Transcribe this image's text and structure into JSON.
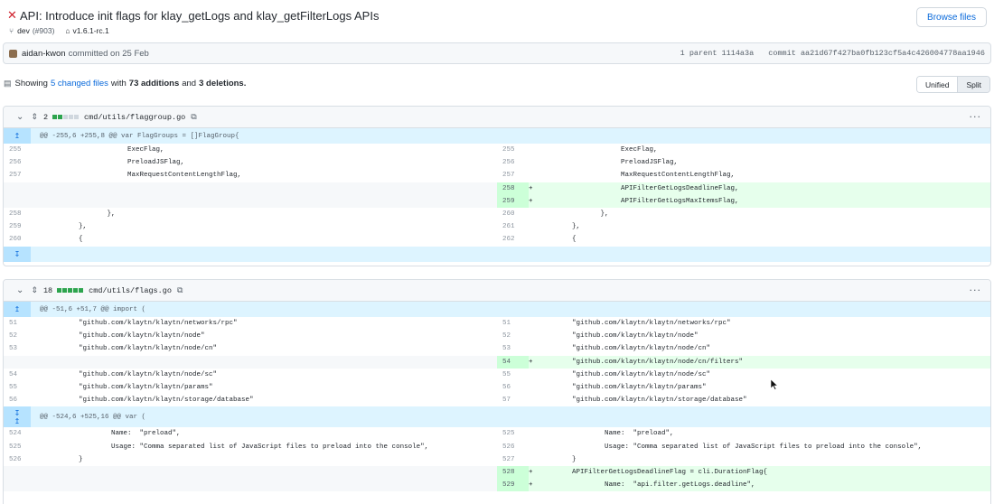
{
  "header": {
    "title": "API: Introduce init flags for klay_getLogs and klay_getFilterLogs APIs",
    "branch": "dev",
    "pr": "(#903)",
    "tag": "v1.6.1-rc.1",
    "browse_files": "Browse files"
  },
  "commit": {
    "author": "aidan-kwon",
    "text": "committed on 25 Feb",
    "parent": "1 parent 1114a3a",
    "hash": "commit aa21d67f427ba0fb123cf5a4c426004778aa1946"
  },
  "summary": {
    "prefix": "Showing",
    "changed": "5 changed files",
    "with": "with",
    "additions": "73 additions",
    "and": "and",
    "deletions": "3 deletions.",
    "view_unified": "Unified",
    "view_split": "Split"
  },
  "files": [
    {
      "count": "2",
      "path": "cmd/utils/flaggroup.go",
      "bars": [
        "add",
        "add",
        "neu",
        "neu",
        "neu"
      ],
      "hunk": "@@ -255,6 +255,8 @@ var FlagGroups = []FlagGroup{",
      "rows": [
        {
          "l": "255",
          "lc": "                    ExecFlag,",
          "r": "255",
          "rc": "                    ExecFlag,",
          "t": "ctx"
        },
        {
          "l": "256",
          "lc": "                    PreloadJSFlag,",
          "r": "256",
          "rc": "                    PreloadJSFlag,",
          "t": "ctx"
        },
        {
          "l": "257",
          "lc": "                    MaxRequestContentLengthFlag,",
          "r": "257",
          "rc": "                    MaxRequestContentLengthFlag,",
          "t": "ctx"
        },
        {
          "l": "",
          "lc": "",
          "r": "258",
          "rc": "                    APIFilterGetLogsDeadlineFlag,",
          "t": "add"
        },
        {
          "l": "",
          "lc": "",
          "r": "259",
          "rc": "                    APIFilterGetLogsMaxItemsFlag,",
          "t": "add"
        },
        {
          "l": "258",
          "lc": "               },",
          "r": "260",
          "rc": "               },",
          "t": "ctx"
        },
        {
          "l": "259",
          "lc": "        },",
          "r": "261",
          "rc": "        },",
          "t": "ctx"
        },
        {
          "l": "260",
          "lc": "        {",
          "r": "262",
          "rc": "        {",
          "t": "ctx"
        }
      ]
    },
    {
      "count": "18",
      "path": "cmd/utils/flags.go",
      "bars": [
        "add",
        "add",
        "add",
        "add",
        "add"
      ],
      "hunk": "@@ -51,6 +51,7 @@ import (",
      "rows": [
        {
          "l": "51",
          "lc": "        \"github.com/klaytn/klaytn/networks/rpc\"",
          "r": "51",
          "rc": "        \"github.com/klaytn/klaytn/networks/rpc\"",
          "t": "ctx"
        },
        {
          "l": "52",
          "lc": "        \"github.com/klaytn/klaytn/node\"",
          "r": "52",
          "rc": "        \"github.com/klaytn/klaytn/node\"",
          "t": "ctx"
        },
        {
          "l": "53",
          "lc": "        \"github.com/klaytn/klaytn/node/cn\"",
          "r": "53",
          "rc": "        \"github.com/klaytn/klaytn/node/cn\"",
          "t": "ctx"
        },
        {
          "l": "",
          "lc": "",
          "r": "54",
          "rc": "        \"github.com/klaytn/klaytn/node/cn/filters\"",
          "t": "add"
        },
        {
          "l": "54",
          "lc": "        \"github.com/klaytn/klaytn/node/sc\"",
          "r": "55",
          "rc": "        \"github.com/klaytn/klaytn/node/sc\"",
          "t": "ctx"
        },
        {
          "l": "55",
          "lc": "        \"github.com/klaytn/klaytn/params\"",
          "r": "56",
          "rc": "        \"github.com/klaytn/klaytn/params\"",
          "t": "ctx"
        },
        {
          "l": "56",
          "lc": "        \"github.com/klaytn/klaytn/storage/database\"",
          "r": "57",
          "rc": "        \"github.com/klaytn/klaytn/storage/database\"",
          "t": "ctx"
        }
      ],
      "hunk2": "@@ -524,6 +525,16 @@ var (",
      "rows2": [
        {
          "l": "524",
          "lc": "                Name:  \"preload\",",
          "r": "525",
          "rc": "                Name:  \"preload\",",
          "t": "ctx"
        },
        {
          "l": "525",
          "lc": "                Usage: \"Comma separated list of JavaScript files to preload into the console\",",
          "r": "526",
          "rc": "                Usage: \"Comma separated list of JavaScript files to preload into the console\",",
          "t": "ctx"
        },
        {
          "l": "526",
          "lc": "        }",
          "r": "527",
          "rc": "        }",
          "t": "ctx"
        },
        {
          "l": "",
          "lc": "",
          "r": "528",
          "rc": "        APIFilterGetLogsDeadlineFlag = cli.DurationFlag{",
          "t": "add"
        },
        {
          "l": "",
          "lc": "",
          "r": "529",
          "rc": "                Name:  \"api.filter.getLogs.deadline\",",
          "t": "add"
        }
      ]
    }
  ]
}
